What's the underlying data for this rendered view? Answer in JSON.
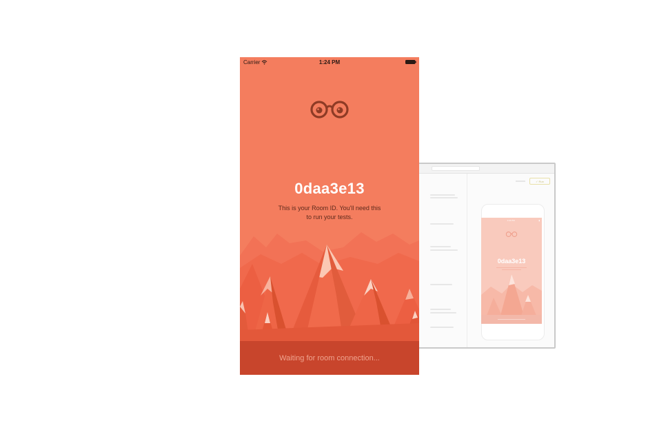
{
  "colors": {
    "screen_background": "#f47d5e",
    "footer_background": "#c8452c",
    "footer_text": "#f0a48f",
    "room_id_text": "#ffffff",
    "logo": "#8e3b25"
  },
  "status_bar": {
    "carrier": "Carrier",
    "time": "1:24 PM"
  },
  "logo_icon": "binoculars-icon",
  "room": {
    "id": "0daa3e13",
    "description_line1": "This is your Room ID. You'll need this",
    "description_line2": "to run your tests."
  },
  "footer": {
    "status_text": "Waiting for room connection..."
  },
  "background_window": {
    "run_button_label": "✓ Run",
    "mini_room_id": "0daa3e13",
    "mini_status_time": "1:24 PM"
  }
}
